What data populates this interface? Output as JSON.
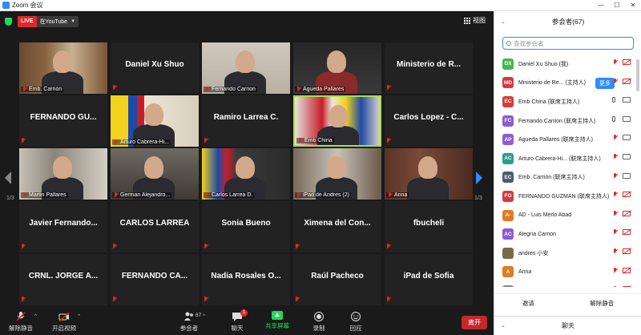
{
  "window": {
    "title": "Zoom 会议",
    "controls": [
      "—",
      "☐",
      "✕"
    ]
  },
  "meeting": {
    "live_badge": "LIVE",
    "live_destination": "在YouTube",
    "view_label": "视图",
    "page_left": "1/3",
    "page_right": "1/3"
  },
  "tiles": [
    {
      "type": "video",
      "label": "Emb. Carrión",
      "scene": "library"
    },
    {
      "type": "name",
      "name": "Daniel Xu Shuo"
    },
    {
      "type": "video",
      "label": "Fernando Carrion",
      "scene": "man-glasses"
    },
    {
      "type": "video",
      "label": "Agueda Pallares",
      "scene": "woman"
    },
    {
      "type": "name",
      "name": "Ministerio de R..."
    },
    {
      "type": "name",
      "name": "FERNANDO GU..."
    },
    {
      "type": "video",
      "label": "Arturo Cabrera-Hi...",
      "scene": "flag-ec"
    },
    {
      "type": "name",
      "name": "Ramiro Larrea C."
    },
    {
      "type": "video",
      "label": "Emb China",
      "scene": "flags-speaker",
      "active": true
    },
    {
      "type": "name",
      "name": "Carlos Lopez - C..."
    },
    {
      "type": "video",
      "label": "Martin Pallares",
      "scene": "man-room"
    },
    {
      "type": "video",
      "label": "German Alejandro...",
      "scene": "man-dark"
    },
    {
      "type": "video",
      "label": "Carlos Larrea D.",
      "scene": "flag-suit"
    },
    {
      "type": "video",
      "label": "iPad de Andres (2)",
      "scene": "man-window"
    },
    {
      "type": "video",
      "label": "Anna",
      "scene": "group"
    },
    {
      "type": "name",
      "name": "Javier Fernando..."
    },
    {
      "type": "name",
      "name": "CARLOS LARREA"
    },
    {
      "type": "name",
      "name": "Sonia Bueno"
    },
    {
      "type": "name",
      "name": "Ximena del Con..."
    },
    {
      "type": "name",
      "name": "fbucheli"
    },
    {
      "type": "name",
      "name": "CRNL. JORGE A..."
    },
    {
      "type": "name",
      "name": "FERNANDO CA..."
    },
    {
      "type": "name",
      "name": "Nadia Rosales O..."
    },
    {
      "type": "name",
      "name": "Raúl Pacheco"
    },
    {
      "type": "name",
      "name": "iPad de Sofia"
    }
  ],
  "toolbar": {
    "unmute": "解除静音",
    "start_video": "开启视频",
    "participants": "参会者",
    "participants_count": "67",
    "chat": "聊天",
    "chat_badge": "1",
    "share": "共享屏幕",
    "record": "录制",
    "reactions": "回应",
    "leave": "离开"
  },
  "sidebar": {
    "title": "参会者(67)",
    "search_placeholder": "查找参会者",
    "more_button": "更多",
    "invite": "邀请",
    "unmute_me": "解除静音",
    "chat_header": "聊天",
    "participants": [
      {
        "initials": "DX",
        "color": "#3fb950",
        "name": "Daniel Xu Shuo (我)",
        "mic": "off",
        "cam": "off"
      },
      {
        "initials": "MD",
        "color": "#d63a3a",
        "name": "Ministerio de Re... (主持人)",
        "mic": "off",
        "cam": "off",
        "more": true
      },
      {
        "initials": "EC",
        "color": "#d63a3a",
        "name": "Emb China (联席主持人)",
        "mic": "on",
        "cam": "on"
      },
      {
        "initials": "FC",
        "color": "#8e5bd6",
        "name": "Fernando Carrion (联席主持人)",
        "mic": "on",
        "cam": "on"
      },
      {
        "initials": "AP",
        "color": "#8e5bd6",
        "name": "Agueda Pallares (联席主持人)",
        "mic": "off",
        "cam": "on"
      },
      {
        "initials": "AC",
        "color": "#2a9d8f",
        "name": "Arturo Cabrera-Hi... (联席主持人)",
        "mic": "off",
        "cam": "on"
      },
      {
        "initials": "EC",
        "color": "#4a5b6e",
        "name": "Emb. Carrión (联席主持人)",
        "mic": "off",
        "cam": "on"
      },
      {
        "initials": "FG",
        "color": "#d63a3a",
        "name": "FERNANDO GUZMAN (联席主持人)",
        "mic": "off",
        "cam": "off"
      },
      {
        "initials": "A-",
        "color": "#e07b24",
        "name": "AD - Luis Merlo Abad",
        "mic": "off",
        "cam": "off"
      },
      {
        "initials": "AC",
        "color": "#8e5bd6",
        "name": "Alegría Carrión",
        "mic": "off",
        "cam": "off"
      },
      {
        "initials": "",
        "color": "#7a6a4a",
        "name": "andres 小安",
        "mic": "off",
        "cam": "off"
      },
      {
        "initials": "A",
        "color": "#e07b24",
        "name": "Anna",
        "mic": "off",
        "cam": "off"
      },
      {
        "initials": "",
        "color": "#888888",
        "name": "Ariel Vergara",
        "mic": "off",
        "cam": "off"
      }
    ]
  }
}
